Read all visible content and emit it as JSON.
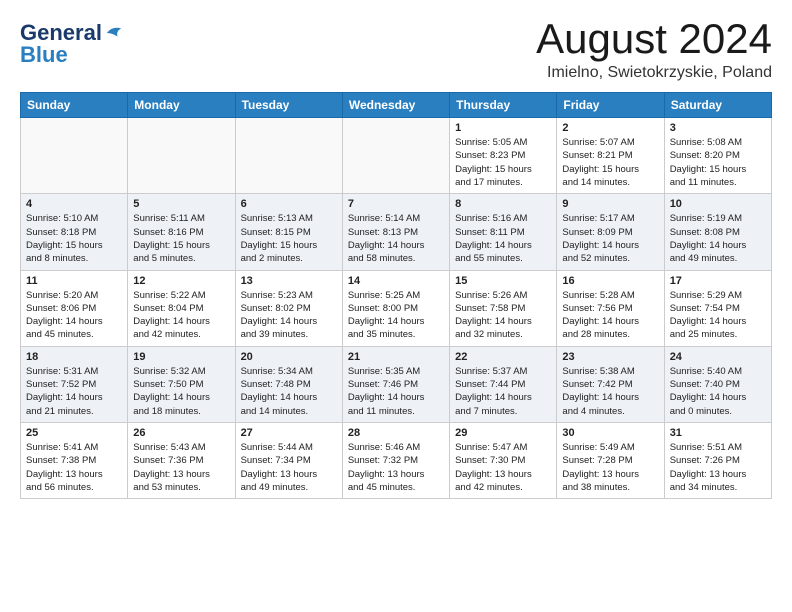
{
  "header": {
    "logo_general": "General",
    "logo_blue": "Blue",
    "month_title": "August 2024",
    "location": "Imielno, Swietokrzyskie, Poland"
  },
  "days_of_week": [
    "Sunday",
    "Monday",
    "Tuesday",
    "Wednesday",
    "Thursday",
    "Friday",
    "Saturday"
  ],
  "weeks": [
    [
      {
        "day": "",
        "info": ""
      },
      {
        "day": "",
        "info": ""
      },
      {
        "day": "",
        "info": ""
      },
      {
        "day": "",
        "info": ""
      },
      {
        "day": "1",
        "info": "Sunrise: 5:05 AM\nSunset: 8:23 PM\nDaylight: 15 hours\nand 17 minutes."
      },
      {
        "day": "2",
        "info": "Sunrise: 5:07 AM\nSunset: 8:21 PM\nDaylight: 15 hours\nand 14 minutes."
      },
      {
        "day": "3",
        "info": "Sunrise: 5:08 AM\nSunset: 8:20 PM\nDaylight: 15 hours\nand 11 minutes."
      }
    ],
    [
      {
        "day": "4",
        "info": "Sunrise: 5:10 AM\nSunset: 8:18 PM\nDaylight: 15 hours\nand 8 minutes."
      },
      {
        "day": "5",
        "info": "Sunrise: 5:11 AM\nSunset: 8:16 PM\nDaylight: 15 hours\nand 5 minutes."
      },
      {
        "day": "6",
        "info": "Sunrise: 5:13 AM\nSunset: 8:15 PM\nDaylight: 15 hours\nand 2 minutes."
      },
      {
        "day": "7",
        "info": "Sunrise: 5:14 AM\nSunset: 8:13 PM\nDaylight: 14 hours\nand 58 minutes."
      },
      {
        "day": "8",
        "info": "Sunrise: 5:16 AM\nSunset: 8:11 PM\nDaylight: 14 hours\nand 55 minutes."
      },
      {
        "day": "9",
        "info": "Sunrise: 5:17 AM\nSunset: 8:09 PM\nDaylight: 14 hours\nand 52 minutes."
      },
      {
        "day": "10",
        "info": "Sunrise: 5:19 AM\nSunset: 8:08 PM\nDaylight: 14 hours\nand 49 minutes."
      }
    ],
    [
      {
        "day": "11",
        "info": "Sunrise: 5:20 AM\nSunset: 8:06 PM\nDaylight: 14 hours\nand 45 minutes."
      },
      {
        "day": "12",
        "info": "Sunrise: 5:22 AM\nSunset: 8:04 PM\nDaylight: 14 hours\nand 42 minutes."
      },
      {
        "day": "13",
        "info": "Sunrise: 5:23 AM\nSunset: 8:02 PM\nDaylight: 14 hours\nand 39 minutes."
      },
      {
        "day": "14",
        "info": "Sunrise: 5:25 AM\nSunset: 8:00 PM\nDaylight: 14 hours\nand 35 minutes."
      },
      {
        "day": "15",
        "info": "Sunrise: 5:26 AM\nSunset: 7:58 PM\nDaylight: 14 hours\nand 32 minutes."
      },
      {
        "day": "16",
        "info": "Sunrise: 5:28 AM\nSunset: 7:56 PM\nDaylight: 14 hours\nand 28 minutes."
      },
      {
        "day": "17",
        "info": "Sunrise: 5:29 AM\nSunset: 7:54 PM\nDaylight: 14 hours\nand 25 minutes."
      }
    ],
    [
      {
        "day": "18",
        "info": "Sunrise: 5:31 AM\nSunset: 7:52 PM\nDaylight: 14 hours\nand 21 minutes."
      },
      {
        "day": "19",
        "info": "Sunrise: 5:32 AM\nSunset: 7:50 PM\nDaylight: 14 hours\nand 18 minutes."
      },
      {
        "day": "20",
        "info": "Sunrise: 5:34 AM\nSunset: 7:48 PM\nDaylight: 14 hours\nand 14 minutes."
      },
      {
        "day": "21",
        "info": "Sunrise: 5:35 AM\nSunset: 7:46 PM\nDaylight: 14 hours\nand 11 minutes."
      },
      {
        "day": "22",
        "info": "Sunrise: 5:37 AM\nSunset: 7:44 PM\nDaylight: 14 hours\nand 7 minutes."
      },
      {
        "day": "23",
        "info": "Sunrise: 5:38 AM\nSunset: 7:42 PM\nDaylight: 14 hours\nand 4 minutes."
      },
      {
        "day": "24",
        "info": "Sunrise: 5:40 AM\nSunset: 7:40 PM\nDaylight: 14 hours\nand 0 minutes."
      }
    ],
    [
      {
        "day": "25",
        "info": "Sunrise: 5:41 AM\nSunset: 7:38 PM\nDaylight: 13 hours\nand 56 minutes."
      },
      {
        "day": "26",
        "info": "Sunrise: 5:43 AM\nSunset: 7:36 PM\nDaylight: 13 hours\nand 53 minutes."
      },
      {
        "day": "27",
        "info": "Sunrise: 5:44 AM\nSunset: 7:34 PM\nDaylight: 13 hours\nand 49 minutes."
      },
      {
        "day": "28",
        "info": "Sunrise: 5:46 AM\nSunset: 7:32 PM\nDaylight: 13 hours\nand 45 minutes."
      },
      {
        "day": "29",
        "info": "Sunrise: 5:47 AM\nSunset: 7:30 PM\nDaylight: 13 hours\nand 42 minutes."
      },
      {
        "day": "30",
        "info": "Sunrise: 5:49 AM\nSunset: 7:28 PM\nDaylight: 13 hours\nand 38 minutes."
      },
      {
        "day": "31",
        "info": "Sunrise: 5:51 AM\nSunset: 7:26 PM\nDaylight: 13 hours\nand 34 minutes."
      }
    ]
  ]
}
